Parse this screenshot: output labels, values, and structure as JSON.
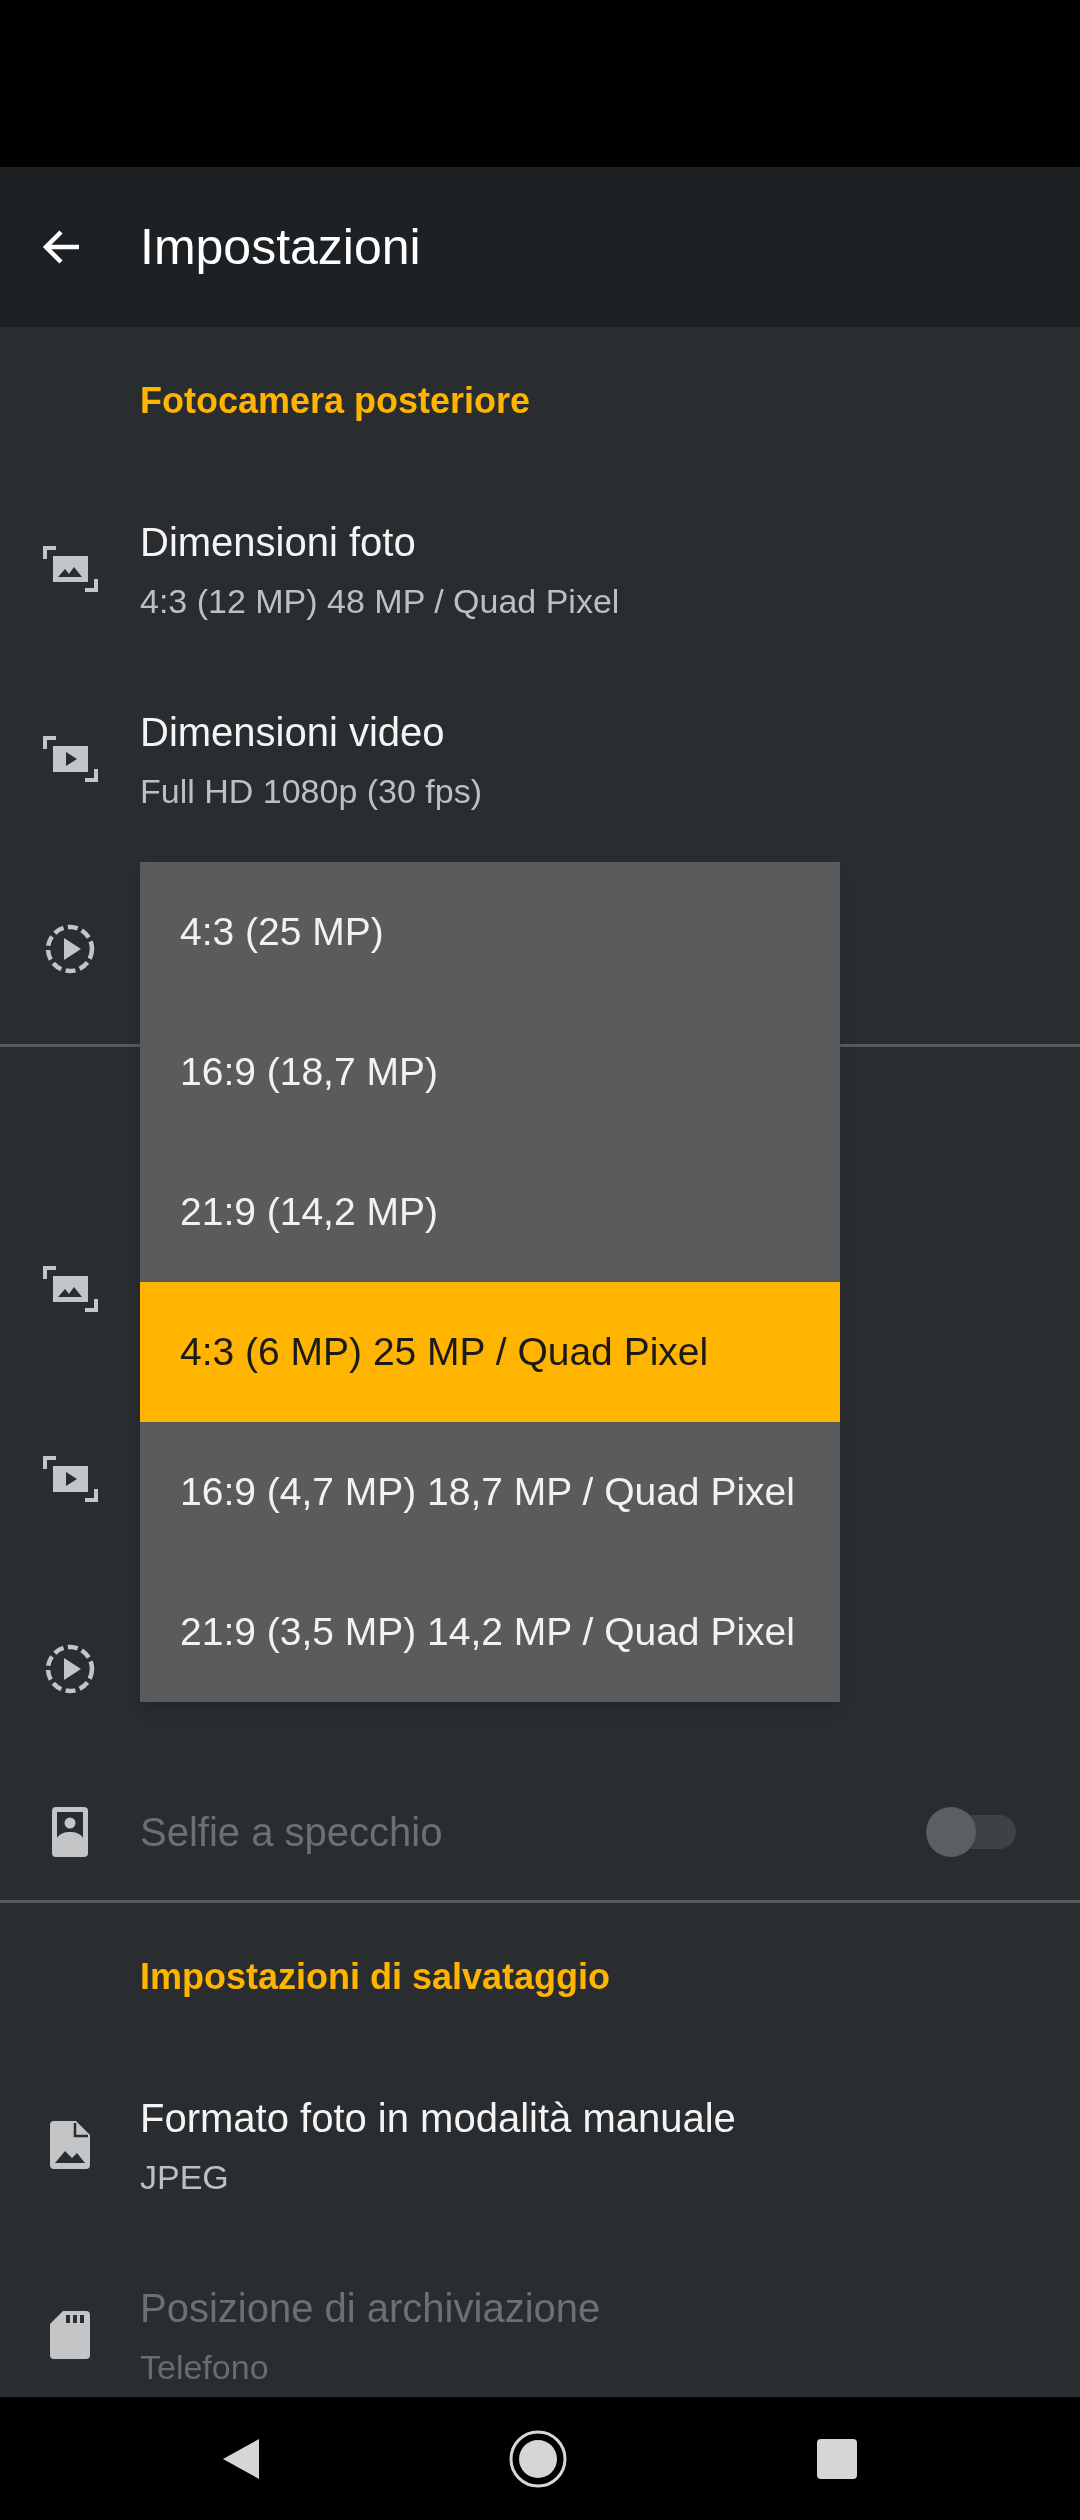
{
  "app_bar": {
    "title": "Impostazioni"
  },
  "sections": [
    {
      "header": "Fotocamera posteriore",
      "rows": [
        {
          "kind": "photo_size",
          "title": "Dimensioni foto",
          "subtitle": "4:3 (12 MP) 48 MP / Quad Pixel",
          "disabled": false
        },
        {
          "kind": "video_size",
          "title": "Dimensioni video",
          "subtitle": "Full HD 1080p (30 fps)",
          "disabled": false
        },
        {
          "kind": "slow_motion"
        }
      ]
    },
    {
      "rows": [
        {
          "kind": "photo_size"
        },
        {
          "kind": "video_size"
        },
        {
          "kind": "slow_motion"
        },
        {
          "kind": "mirror",
          "title": "Selfie a specchio",
          "disabled": true,
          "switch_on": false
        }
      ]
    },
    {
      "header": "Impostazioni di salvataggio",
      "rows": [
        {
          "kind": "file_format",
          "title": "Formato foto in modalità manuale",
          "subtitle": "JPEG",
          "disabled": false
        },
        {
          "kind": "storage",
          "title": "Posizione di archiviazione",
          "subtitle": "Telefono",
          "disabled": true
        }
      ]
    }
  ],
  "dropdown": {
    "options": [
      {
        "label": "4:3 (25 MP)",
        "selected": false
      },
      {
        "label": "16:9 (18,7 MP)",
        "selected": false
      },
      {
        "label": "21:9 (14,2 MP)",
        "selected": false
      },
      {
        "label": "4:3 (6 MP) 25 MP / Quad Pixel",
        "selected": true
      },
      {
        "label": "16:9 (4,7 MP) 18,7 MP / Quad Pixel",
        "selected": false
      },
      {
        "label": "21:9 (3,5 MP) 14,2 MP / Quad Pixel",
        "selected": false
      }
    ]
  }
}
